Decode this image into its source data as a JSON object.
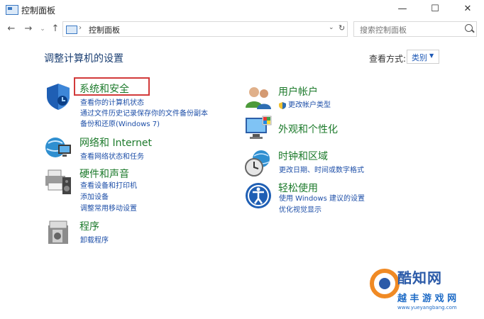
{
  "window": {
    "title": "控制面板",
    "min_glyph": "—",
    "max_glyph": "☐",
    "close_glyph": "✕"
  },
  "address": {
    "back_glyph": "←",
    "forward_glyph": "→",
    "history_glyph": "⌄",
    "up_glyph": "↑",
    "separator": "›",
    "path": "控制面板",
    "drop_glyph": "⌄",
    "refresh_glyph": "↻"
  },
  "search": {
    "placeholder": "搜索控制面板"
  },
  "page": {
    "title": "调整计算机的设置",
    "view_by_label": "查看方式:",
    "view_by_value": "类别",
    "view_by_arrow": "▼"
  },
  "categories_left": [
    {
      "title": "系统和安全",
      "icon": "shield-icon",
      "links": [
        "查看你的计算机状态",
        "通过文件历史记录保存你的文件备份副本",
        "备份和还原(Windows 7)"
      ]
    },
    {
      "title": "网络和 Internet",
      "icon": "network-globe-icon",
      "links": [
        "查看网络状态和任务"
      ]
    },
    {
      "title": "硬件和声音",
      "icon": "printer-speaker-icon",
      "links": [
        "查看设备和打印机",
        "添加设备",
        "调整常用移动设置"
      ]
    },
    {
      "title": "程序",
      "icon": "programs-box-icon",
      "links": [
        "卸载程序"
      ]
    }
  ],
  "categories_right": [
    {
      "title": "用户帐户",
      "icon": "users-icon",
      "links": [
        "更改帐户类型"
      ]
    },
    {
      "title": "外观和个性化",
      "icon": "monitor-palette-icon",
      "links": []
    },
    {
      "title": "时钟和区域",
      "icon": "clock-globe-icon",
      "links": [
        "更改日期、时间或数字格式"
      ]
    },
    {
      "title": "轻松使用",
      "icon": "accessibility-icon",
      "links": [
        "使用 Windows 建议的设置",
        "优化视觉显示"
      ]
    }
  ],
  "watermark": {
    "line1": "酷知网",
    "line2": "越 丰 游 戏 网",
    "line3": "www.yueyangbang.com"
  },
  "colors": {
    "category_title": "#1c7a2b",
    "link": "#1e4fa8",
    "heading": "#1a3e72",
    "highlight": "#d23a3a"
  }
}
